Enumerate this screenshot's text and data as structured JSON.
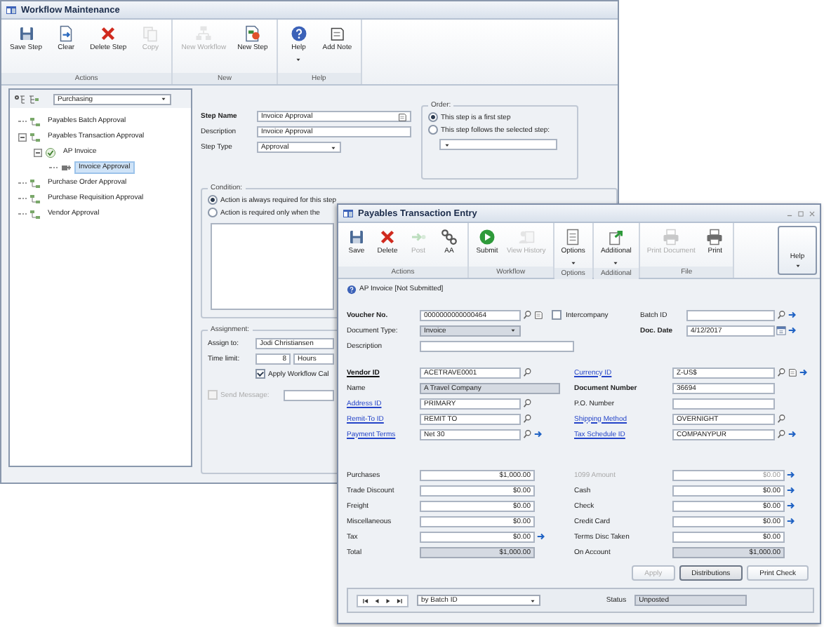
{
  "workflow_window": {
    "title": "Workflow Maintenance",
    "ribbon": [
      {
        "label": "Actions",
        "buttons": [
          {
            "label": "Save Step",
            "disabled": false,
            "dropdown": false
          },
          {
            "label": "Clear",
            "disabled": false,
            "dropdown": false
          },
          {
            "label": "Delete Step",
            "disabled": false,
            "dropdown": false
          },
          {
            "label": "Copy",
            "disabled": true,
            "dropdown": false
          }
        ]
      },
      {
        "label": "New",
        "buttons": [
          {
            "label": "New Workflow",
            "disabled": true,
            "dropdown": false
          },
          {
            "label": "New Step",
            "disabled": false,
            "dropdown": false
          }
        ]
      },
      {
        "label": "Help",
        "buttons": [
          {
            "label": "Help",
            "disabled": false,
            "dropdown": true
          },
          {
            "label": "Add Note",
            "disabled": false,
            "dropdown": false
          }
        ]
      }
    ],
    "tree_filter": {
      "value": "Purchasing"
    },
    "tree": [
      {
        "label": "Payables Batch Approval",
        "kind": "workflow",
        "selected": false
      },
      {
        "label": "Payables Transaction Approval",
        "kind": "workflow",
        "selected": false,
        "expanded": true,
        "children": [
          {
            "label": "AP Invoice",
            "kind": "type",
            "selected": false,
            "expanded": true,
            "children": [
              {
                "label": "Invoice Approval",
                "kind": "step",
                "selected": true
              }
            ]
          }
        ]
      },
      {
        "label": "Purchase Order Approval",
        "kind": "workflow",
        "selected": false
      },
      {
        "label": "Purchase Requisition Approval",
        "kind": "workflow",
        "selected": false
      },
      {
        "label": "Vendor Approval",
        "kind": "workflow",
        "selected": false
      }
    ],
    "step_fields": [
      {
        "label": "Step Name",
        "value": "Invoice Approval",
        "kind": "note",
        "required": true
      },
      {
        "label": "Description",
        "value": "Invoice Approval",
        "kind": "text",
        "required": false
      },
      {
        "label": "Step Type",
        "value": "Approval",
        "kind": "dropdown",
        "required": false
      }
    ],
    "order": {
      "legend": "Order:",
      "options": [
        {
          "label": "This step is a first step",
          "selected": true
        },
        {
          "label": "This step follows the selected step:",
          "selected": false
        }
      ]
    },
    "condition": {
      "legend": "Condition:",
      "options": [
        {
          "label": "Action is always required for this step",
          "selected": true
        },
        {
          "label": "Action is required only when the",
          "selected": false
        }
      ]
    },
    "assignment": {
      "legend": "Assignment:",
      "assign_to": {
        "label": "Assign to:",
        "value": "Jodi Christiansen"
      },
      "time_limit": {
        "label": "Time limit:",
        "value": "8",
        "unit": "Hours"
      },
      "calendar": {
        "label": "Apply Workflow Cal",
        "checked": true
      },
      "send_message": {
        "label": "Send Message:",
        "checked": false,
        "disabled": true
      }
    }
  },
  "payables_window": {
    "title": "Payables Transaction Entry",
    "ribbon": [
      {
        "label": "Actions",
        "buttons": [
          {
            "label": "Save",
            "disabled": false,
            "dropdown": false
          },
          {
            "label": "Delete",
            "disabled": false,
            "dropdown": false
          },
          {
            "label": "Post",
            "disabled": true,
            "dropdown": false
          },
          {
            "label": "AA",
            "disabled": false,
            "dropdown": false
          }
        ]
      },
      {
        "label": "Workflow",
        "buttons": [
          {
            "label": "Submit",
            "disabled": false,
            "dropdown": false
          },
          {
            "label": "View History",
            "disabled": true,
            "dropdown": false
          }
        ]
      },
      {
        "label": "Options",
        "buttons": [
          {
            "label": "Options",
            "disabled": false,
            "dropdown": true
          }
        ]
      },
      {
        "label": "Additional",
        "buttons": [
          {
            "label": "Additional",
            "disabled": false,
            "dropdown": true
          }
        ]
      },
      {
        "label": "File",
        "buttons": [
          {
            "label": "Print Document",
            "disabled": true,
            "dropdown": false
          },
          {
            "label": "Print",
            "disabled": false,
            "dropdown": false
          }
        ]
      }
    ],
    "help_button": {
      "label": "Help",
      "dropdown": true
    },
    "status_note": "AP Invoice [Not Submitted]",
    "document_rows": [
      {
        "left": {
          "label": "Voucher No.",
          "value": "0000000000000464",
          "kind": "lookup_note",
          "required": true,
          "link": false,
          "readonly": false
        },
        "checkbox": {
          "label": "Intercompany",
          "checked": false
        },
        "right": {
          "label": "Batch ID",
          "kind": "lookup_arrow",
          "required": false,
          "link": false,
          "readonly": false
        }
      },
      {
        "left": {
          "label": "Document Type:",
          "value": "Invoice",
          "kind": "dropdown",
          "required": false,
          "link": false,
          "readonly": true
        },
        "right": {
          "label": "Doc. Date",
          "value": "4/12/2017",
          "kind": "date_arrow",
          "required": true,
          "link": false,
          "readonly": false
        }
      },
      {
        "left": {
          "label": "Description",
          "kind": "wide",
          "required": false,
          "link": false,
          "readonly": false
        }
      }
    ],
    "vendor_rows": [
      {
        "left": {
          "label": "Vendor ID",
          "value": "ACETRAVE0001",
          "kind": "lookup",
          "required": true,
          "link": true,
          "readonly": false
        },
        "right": {
          "label": "Currency ID",
          "value": "Z-US$",
          "kind": "lookup_note_arrow",
          "required": false,
          "link": true,
          "readonly": false
        }
      },
      {
        "left": {
          "label": "Name",
          "value": "A Travel Company",
          "kind": "wide",
          "required": false,
          "link": false,
          "readonly": true
        },
        "right": {
          "label": "Document Number",
          "value": "36694",
          "kind": "text",
          "required": true,
          "link": false,
          "readonly": false
        }
      },
      {
        "left": {
          "label": "Address ID",
          "value": "PRIMARY",
          "kind": "lookup",
          "required": false,
          "link": true,
          "readonly": false
        },
        "right": {
          "label": "P.O. Number",
          "kind": "text",
          "required": false,
          "link": false,
          "readonly": false
        }
      },
      {
        "left": {
          "label": "Remit-To ID",
          "value": "REMIT TO",
          "kind": "lookup",
          "required": false,
          "link": true,
          "readonly": false
        },
        "right": {
          "label": "Shipping Method",
          "value": "OVERNIGHT",
          "kind": "lookup",
          "required": false,
          "link": true,
          "readonly": false
        }
      },
      {
        "left": {
          "label": "Payment Terms",
          "value": "Net 30",
          "kind": "lookup_arrow",
          "required": false,
          "link": true,
          "readonly": false
        },
        "right": {
          "label": "Tax Schedule ID",
          "value": "COMPANYPUR",
          "kind": "lookup_arrow",
          "required": false,
          "link": true,
          "readonly": false
        }
      }
    ],
    "amount_rows": [
      {
        "left": {
          "label": "Purchases",
          "value": "$1,000.00",
          "kind": "amount",
          "readonly": false,
          "disabled": false
        },
        "right": {
          "label": "1099 Amount",
          "value": "$0.00",
          "kind": "amount_arrow",
          "readonly": false,
          "disabled": true
        }
      },
      {
        "left": {
          "label": "Trade Discount",
          "value": "$0.00",
          "kind": "amount",
          "readonly": false,
          "disabled": false
        },
        "right": {
          "label": "Cash",
          "value": "$0.00",
          "kind": "amount_arrow",
          "readonly": false,
          "disabled": false
        }
      },
      {
        "left": {
          "label": "Freight",
          "value": "$0.00",
          "kind": "amount",
          "readonly": false,
          "disabled": false
        },
        "right": {
          "label": "Check",
          "value": "$0.00",
          "kind": "amount_arrow",
          "readonly": false,
          "disabled": false
        }
      },
      {
        "left": {
          "label": "Miscellaneous",
          "value": "$0.00",
          "kind": "amount",
          "readonly": false,
          "disabled": false
        },
        "right": {
          "label": "Credit Card",
          "value": "$0.00",
          "kind": "amount_arrow",
          "readonly": false,
          "disabled": false
        }
      },
      {
        "left": {
          "label": "Tax",
          "value": "$0.00",
          "kind": "amount_arrow",
          "readonly": false,
          "disabled": false
        },
        "right": {
          "label": "Terms Disc Taken",
          "value": "$0.00",
          "kind": "amount",
          "readonly": false,
          "disabled": false
        }
      },
      {
        "left": {
          "label": "Total",
          "value": "$1,000.00",
          "kind": "amount",
          "readonly": true,
          "disabled": false
        },
        "right": {
          "label": "On Account",
          "value": "$1,000.00",
          "kind": "amount",
          "readonly": true,
          "disabled": false
        }
      }
    ],
    "buttons": [
      {
        "label": "Apply",
        "disabled": true,
        "focused": false
      },
      {
        "label": "Distributions",
        "disabled": false,
        "focused": true
      },
      {
        "label": "Print Check",
        "disabled": false,
        "focused": false
      }
    ],
    "sort": {
      "value": "by Batch ID"
    },
    "status": {
      "label": "Status",
      "value": "Unposted"
    }
  }
}
